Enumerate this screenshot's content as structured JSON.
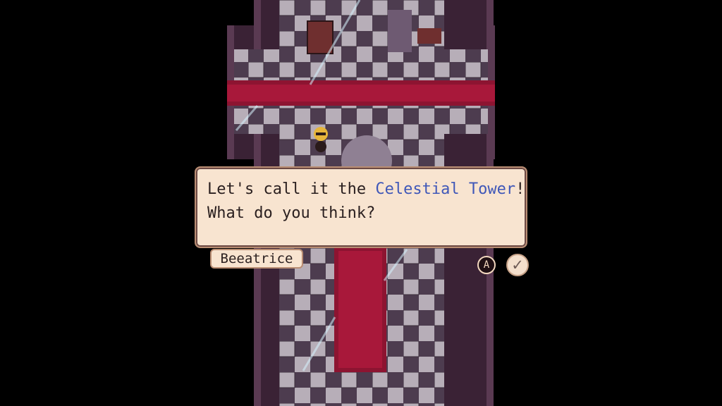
{
  "dialog": {
    "line1_before": "Let's call it the ",
    "highlight": "Celestial Tower",
    "line1_after": "!",
    "line2": "What do you think?",
    "speaker": "Beeatrice"
  },
  "controls": {
    "action_button_label": "A",
    "confirm_icon": "checkmark-icon",
    "confirm_glyph": "✓"
  },
  "colors": {
    "dialog_bg": "#f8e4d0",
    "dialog_border": "#b98d73",
    "highlight_text": "#3f57b8",
    "carpet_red": "#8d1431"
  }
}
